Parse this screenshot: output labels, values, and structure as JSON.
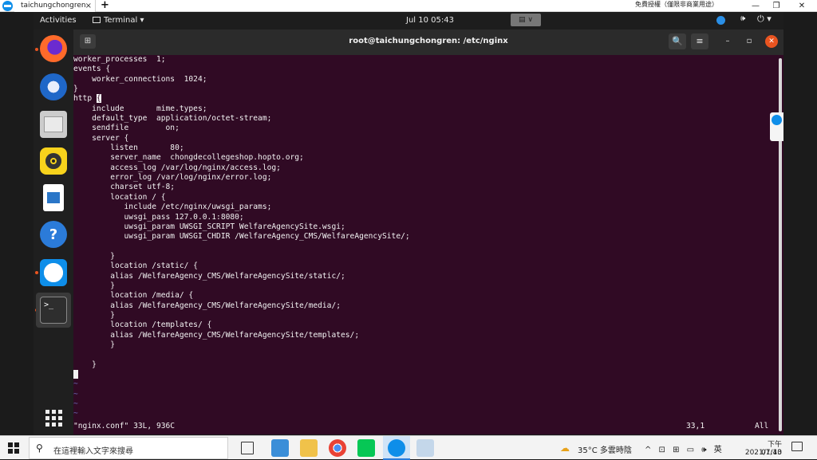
{
  "teamviewer_bar": {
    "tab_label": "taichungchongren",
    "tab_close": "×",
    "add_tab": "+",
    "license_text": "免費授權（僅限非商業用途）",
    "min": "—",
    "max": "❐",
    "close": "✕"
  },
  "top_panel": {
    "activities": "Activities",
    "app_menu": "Terminal ▾",
    "clock": "Jul 10  05:43",
    "volume_icon": "🕪",
    "power_icon": "⏻ ▾"
  },
  "dock": {
    "items": [
      "firefox-icon",
      "thunderbird-icon",
      "files-icon",
      "rhythmbox-icon",
      "libreoffice-writer-icon",
      "help-icon",
      "teamviewer-icon",
      "terminal-icon",
      "show-applications-icon"
    ],
    "help_glyph": "?",
    "terminal_glyph": ">_"
  },
  "terminal": {
    "title": "root@taichungchongren: /etc/nginx",
    "new_tab_glyph": "⊞",
    "search_glyph": "🔍",
    "menu_glyph": "≡",
    "minimize_glyph": "–",
    "maximize_glyph": "▫",
    "close_glyph": "✕",
    "lines": [
      "worker_processes  1;",
      "events {",
      "    worker_connections  1024;",
      "}",
      "http ",
      "    include       mime.types;",
      "    default_type  application/octet-stream;",
      "    sendfile        on;",
      "    server {",
      "        listen       80;",
      "        server_name  chongdecollegeshop.hopto.org;",
      "        access_log /var/log/nginx/access.log;",
      "        error_log /var/log/nginx/error.log;",
      "        charset utf-8;",
      "        location / {",
      "           include /etc/nginx/uwsgi_params;",
      "           uwsgi_pass 127.0.0.1:8080;",
      "           uwsgi_param UWSGI_SCRIPT WelfareAgencySite.wsgi;",
      "           uwsgi_param UWSGI_CHDIR /WelfareAgency_CMS/WelfareAgencySite/;",
      "",
      "        }",
      "        location /static/ {",
      "        alias /WelfareAgency_CMS/WelfareAgencySite/static/;",
      "        }",
      "        location /media/ {",
      "        alias /WelfareAgency_CMS/WelfareAgencySite/media/;",
      "        }",
      "        location /templates/ {",
      "        alias /WelfareAgency_CMS/WelfareAgencySite/templates/;",
      "        }",
      "",
      "    }",
      ""
    ],
    "highlighted_brace": "{",
    "tildes": [
      "~",
      "~",
      "~",
      "~"
    ],
    "status_file": "\"nginx.conf\" 33L, 936C",
    "status_position": "33,1",
    "status_scroll": "All"
  },
  "taskbar": {
    "search_icon": "⚲",
    "search_placeholder": "在這裡輸入文字來搜尋",
    "weather_icon": "☁",
    "weather": "35°C  多雲時陰",
    "tray": "^ ⊡ ⊞ ▭ 🕪 英",
    "ime": "",
    "time": "下午 01:43",
    "date": "2021/7/10"
  }
}
